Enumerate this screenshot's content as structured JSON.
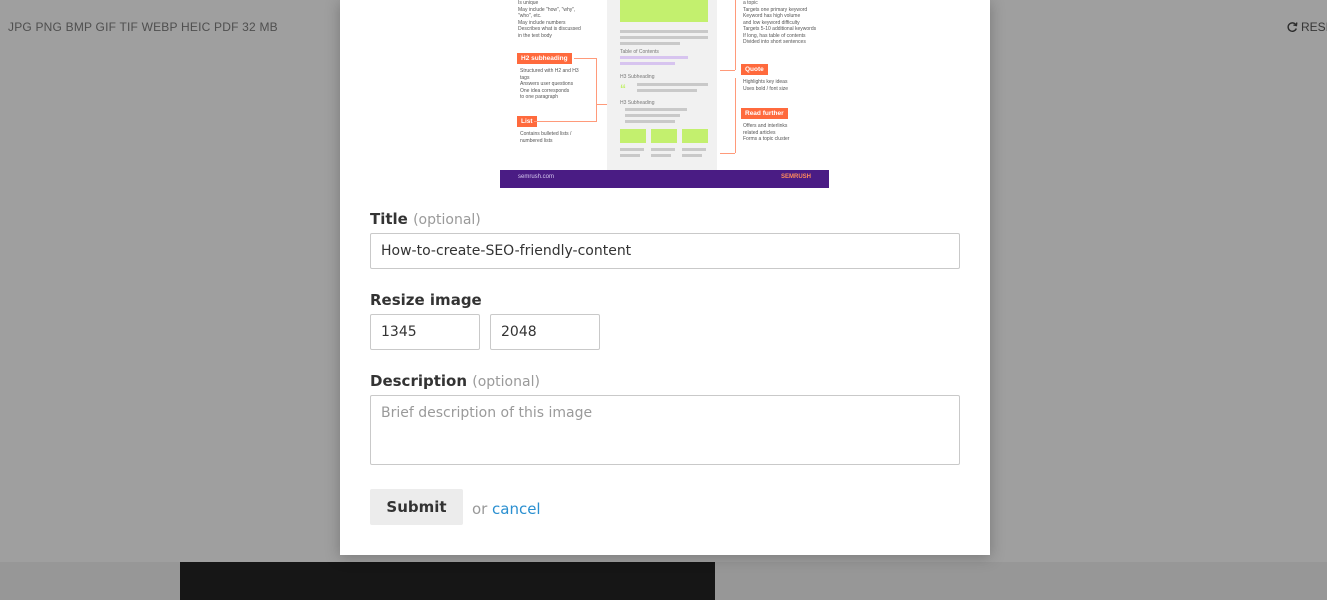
{
  "background": {
    "formats_text": "JPG PNG BMP GIF TIF WEBP HEIC PDF   32 MB",
    "reset_label": "RESI"
  },
  "preview": {
    "left_items": [
      "Is unique",
      "May include \"how\", \"why\",",
      "\"who\", etc.",
      "May include numbers",
      "Describes what is discussed",
      "in the text body"
    ],
    "h2_tag": "H2 subheading",
    "h2_items": [
      "Structured with H2 and H3",
      "tags",
      "Answers user questions",
      "One idea corresponds",
      "to one paragraph"
    ],
    "list_tag": "List",
    "list_items": [
      "Contains bulleted lists /",
      "numbered lists"
    ],
    "toc_label": "Table of Contents",
    "h3_label_1": "H3 Subheading",
    "h3_label_2": "H3 Subheading",
    "right_items": [
      "a topic",
      "Targets one primary keyword",
      "Keyword has high volume",
      "and low keyword difficulty",
      "Targets 5-10 additional keywords",
      "If long, has table of contents",
      "Divided into short sentences"
    ],
    "quote_tag": "Quote",
    "quote_items": [
      "Highlights key ideas",
      "Uses bold / font size"
    ],
    "read_tag": "Read further",
    "read_items": [
      "Offers and interlinks",
      "related articles",
      "Forms a topic cluster"
    ],
    "footer_left": "semrush.com",
    "footer_right": "SEMRUSH"
  },
  "form": {
    "title_label": "Title",
    "optional_text": "(optional)",
    "title_value": "How-to-create-SEO-friendly-content",
    "resize_label": "Resize image",
    "width_value": "1345",
    "height_value": "2048",
    "description_label": "Description",
    "description_optional": "(optional)",
    "description_placeholder": "Brief description of this image",
    "submit_label": "Submit",
    "or_text": "or",
    "cancel_label": "cancel"
  },
  "colors": {
    "accent_link": "#2a8fd0",
    "preview_footer": "#4a1c84",
    "tag_orange": "#ff6a3d",
    "green_block": "#c3f06e"
  },
  "icons": {
    "reset": "refresh-icon"
  }
}
